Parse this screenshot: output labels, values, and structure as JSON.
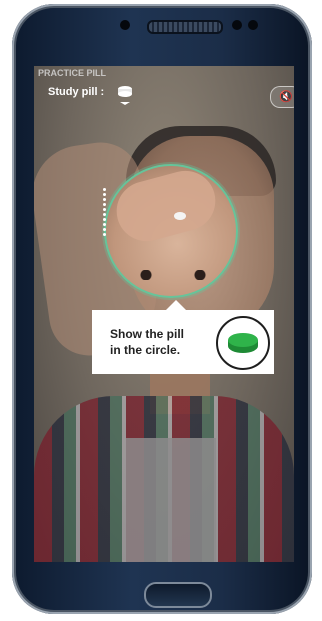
{
  "status_bar": {
    "ghost_text": "PRACTICE PILL"
  },
  "header": {
    "study_label": "Study pill :",
    "pill_icon": "pill-icon",
    "mute_icon": "speaker-muted-icon",
    "mute_glyph": "🔇"
  },
  "overlay": {
    "instruction_line1": "Show the pill",
    "instruction_line2": "in the circle.",
    "pill_button_icon": "green-pill-icon"
  },
  "colors": {
    "circle_outline": "#66c49a",
    "pill_green": "#2fb34a",
    "overlay_text": "#ffffff",
    "callout_bg": "#ffffff"
  }
}
